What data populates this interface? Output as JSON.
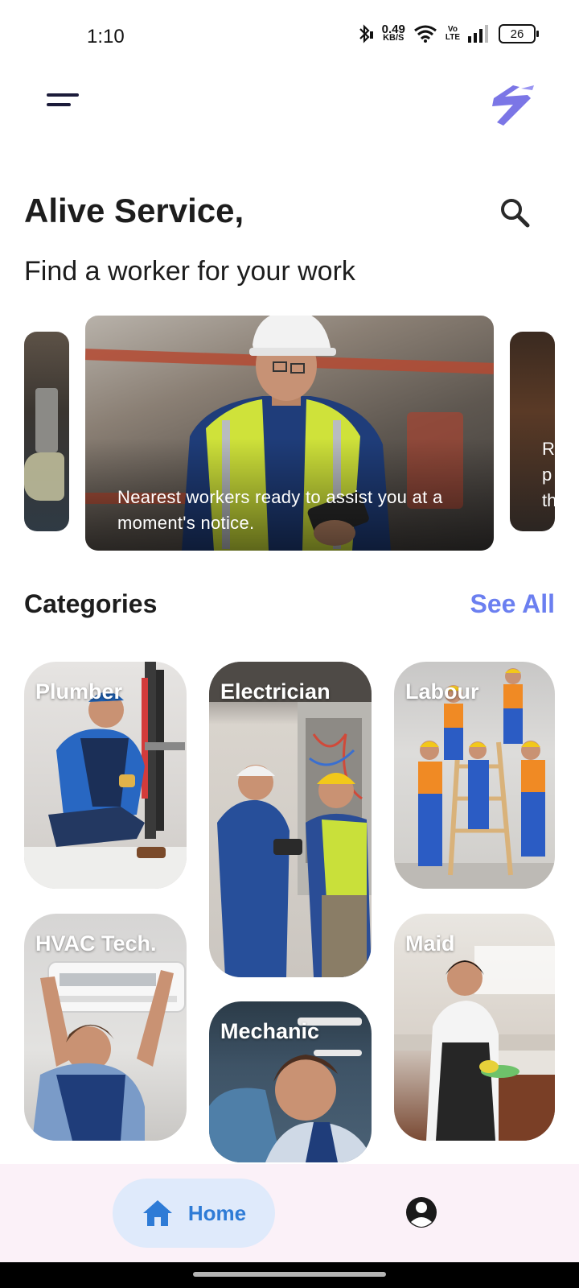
{
  "status_bar": {
    "time": "1:10",
    "net_speed_value": "0.49",
    "net_speed_unit": "KB/S",
    "volte_top": "Vo",
    "volte_bottom": "LTE",
    "battery": "26"
  },
  "header": {
    "menu_icon": "menu-icon",
    "logo_icon": "app-logo-icon",
    "title": "Alive Service,",
    "subtitle": "Find a worker for your work",
    "search_icon": "search-icon"
  },
  "carousel": {
    "slides": [
      {
        "caption": ""
      },
      {
        "caption": "Nearest workers ready to assist you at a moment's notice."
      },
      {
        "caption": "R\np\nth"
      }
    ]
  },
  "categories": {
    "title": "Categories",
    "see_all": "See All",
    "items": [
      {
        "label": "Plumber"
      },
      {
        "label": "Electrician"
      },
      {
        "label": "Labour"
      },
      {
        "label": "HVAC Tech."
      },
      {
        "label": "Mechanic"
      },
      {
        "label": "Maid"
      }
    ]
  },
  "bottom_nav": {
    "home_label": "Home",
    "home_icon": "home-icon",
    "profile_icon": "profile-icon",
    "accent_color": "#2e7bd6"
  },
  "colors": {
    "see_all": "#6b7ff0",
    "logo": "#7b76e6",
    "nav_background": "#fbf1f8",
    "home_pill": "#dfeafb"
  }
}
